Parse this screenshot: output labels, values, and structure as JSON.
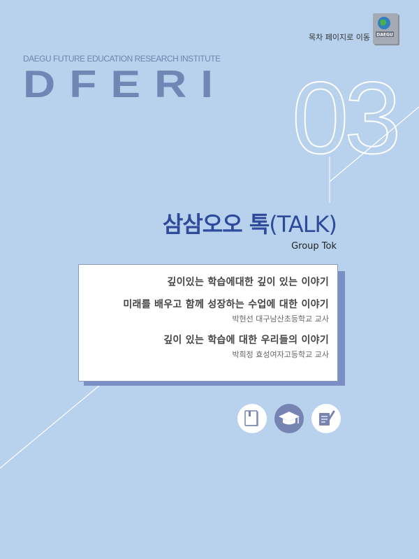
{
  "header": {
    "toc_link": "목차 페이지로 이동",
    "badge_text": "DAEGU"
  },
  "institute": {
    "full_name": "DAEGU FUTURE EDUCATION RESEARCH INSTITUTE",
    "logo": "DFERI"
  },
  "chapter": {
    "number": "03",
    "title_main": "삼삼오오 톡",
    "title_paren": "(TALK)",
    "subtitle": "Group Tok"
  },
  "stories": [
    {
      "title": "깊이있는 학습에대한 깊이 있는 이야기",
      "author": ""
    },
    {
      "title": "미래를 배우고 함께 성장하는 수업에 대한 이야기",
      "author": "박현선 대구남산초등학교 교사"
    },
    {
      "title": "깊이 있는 학습에 대한 우리들의 이야기",
      "author": "박희정 효성여자고등학교 교사"
    }
  ],
  "icons": [
    "book-icon",
    "graduation-cap-icon",
    "document-pen-icon"
  ],
  "colors": {
    "background": "#b8d2ee",
    "accent": "#2e4a9b",
    "logo": "#6f87b5",
    "shadow": "#7b8fc4"
  }
}
